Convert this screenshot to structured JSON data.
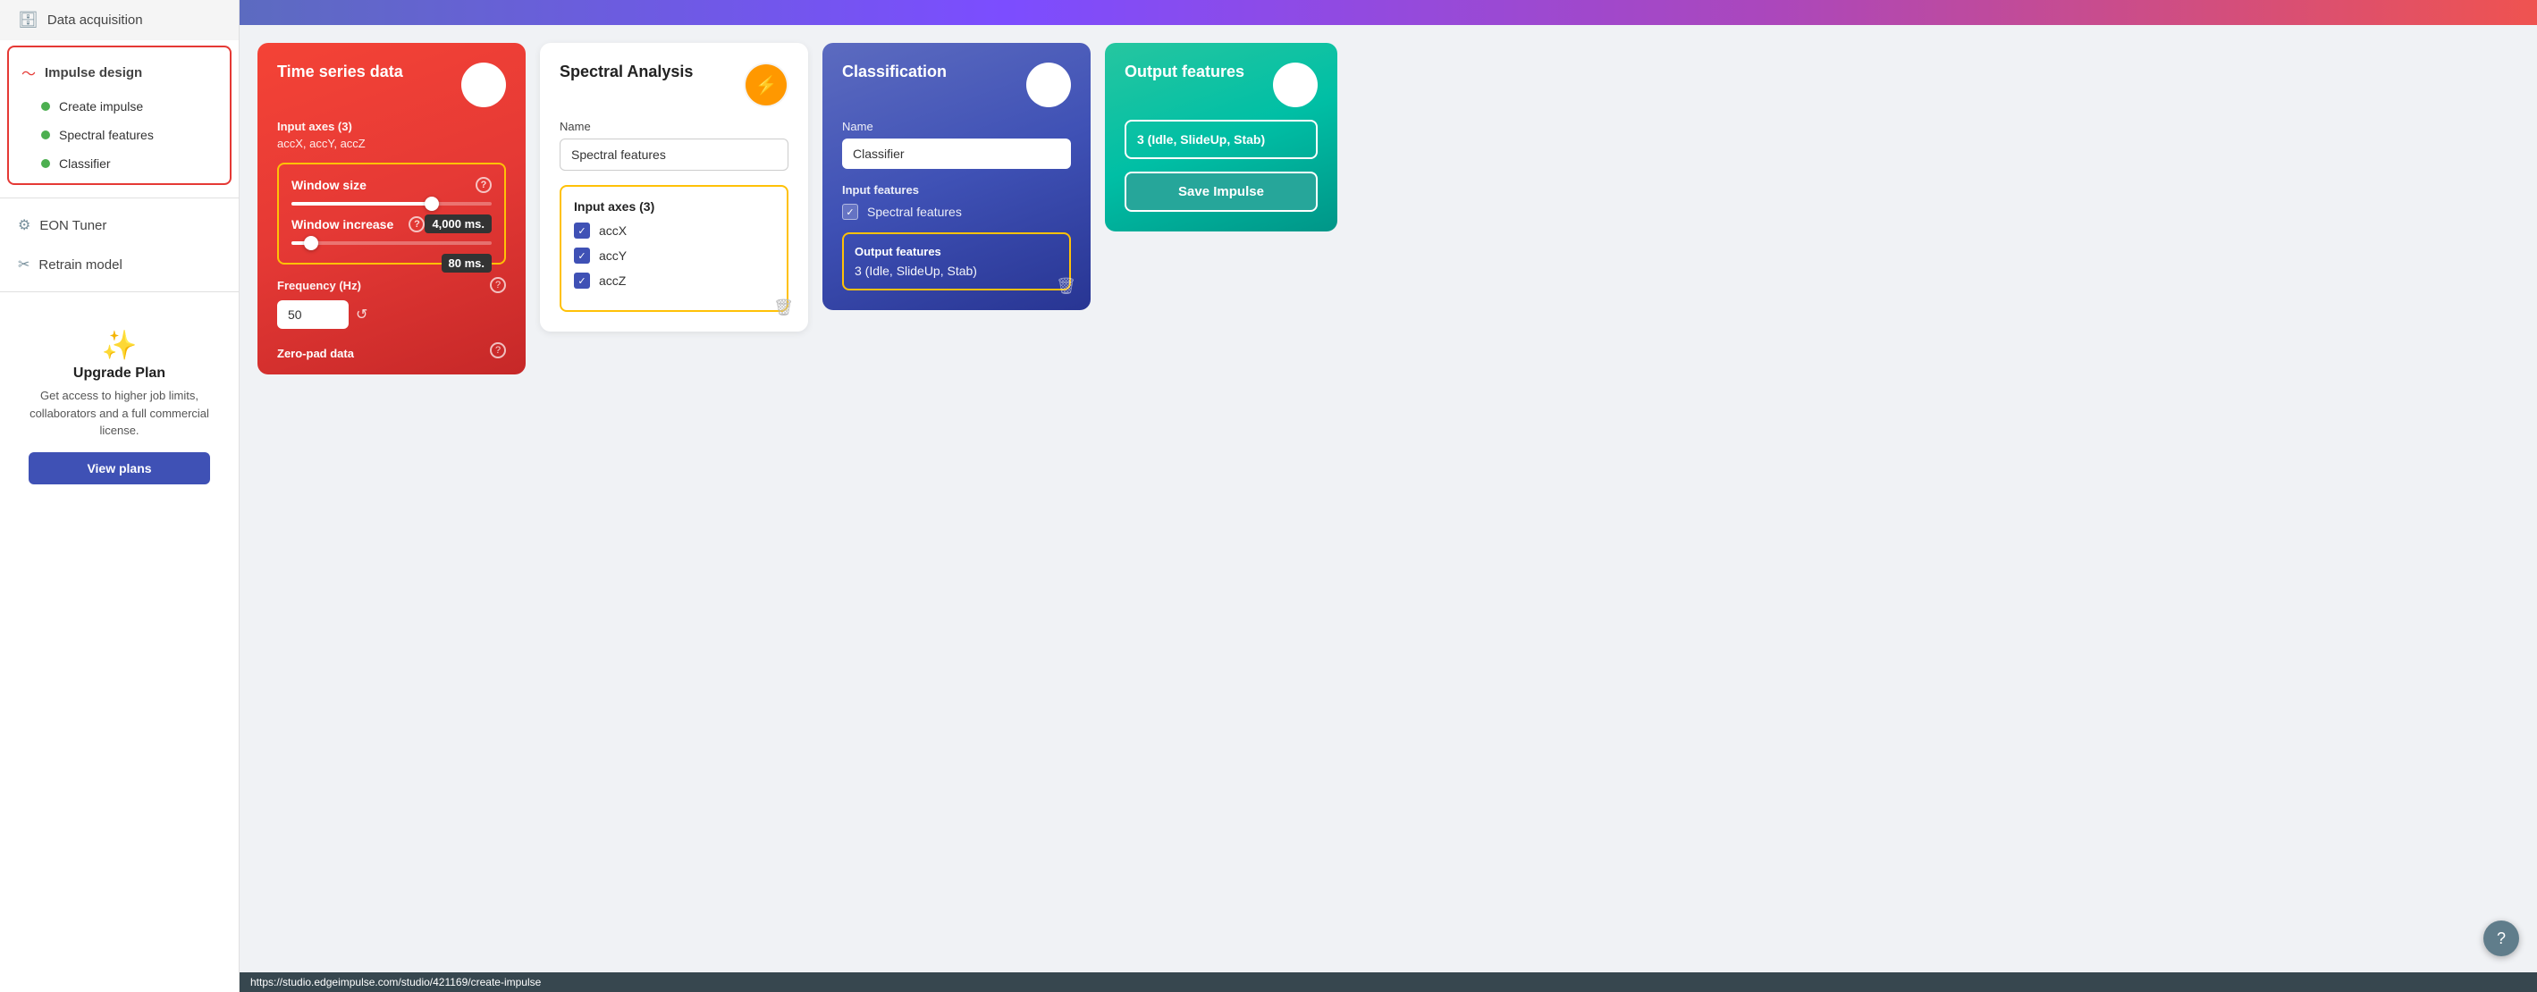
{
  "sidebar": {
    "data_acquisition": "Data acquisition",
    "impulse_design": "Impulse design",
    "create_impulse": "Create impulse",
    "spectral_features": "Spectral features",
    "classifier": "Classifier",
    "eon_tuner": "EON Tuner",
    "retrain_model": "Retrain model",
    "upgrade": {
      "title": "Upgrade Plan",
      "desc": "Get access to higher job limits, collaborators and a full commercial license.",
      "btn": "View plans"
    }
  },
  "timeseries": {
    "title": "Time series data",
    "input_axes_label": "Input axes (3)",
    "input_axes_value": "accX, accY, accZ",
    "window_size_label": "Window size",
    "window_size_value": "4,000 ms.",
    "window_increase_label": "Window increase",
    "window_increase_value": "80 ms.",
    "frequency_label": "Frequency (Hz)",
    "frequency_value": "50",
    "zero_pad_label": "Zero-pad data"
  },
  "spectral": {
    "title": "Spectral Analysis",
    "name_label": "Name",
    "name_value": "Spectral features",
    "input_axes_label": "Input axes (3)",
    "axes": [
      "accX",
      "accY",
      "accZ"
    ]
  },
  "classification": {
    "title": "Classification",
    "name_label": "Name",
    "name_value": "Classifier",
    "input_features_label": "Input features",
    "input_feature_1": "Spectral features",
    "output_features_label": "Output features",
    "output_features_value": "3 (Idle, SlideUp, Stab)"
  },
  "output": {
    "title": "Output features",
    "value": "3 (Idle, SlideUp, Stab)",
    "save_btn": "Save Impulse"
  },
  "status_bar": {
    "url": "https://studio.edgeimpulse.com/studio/421169/create-impulse"
  }
}
